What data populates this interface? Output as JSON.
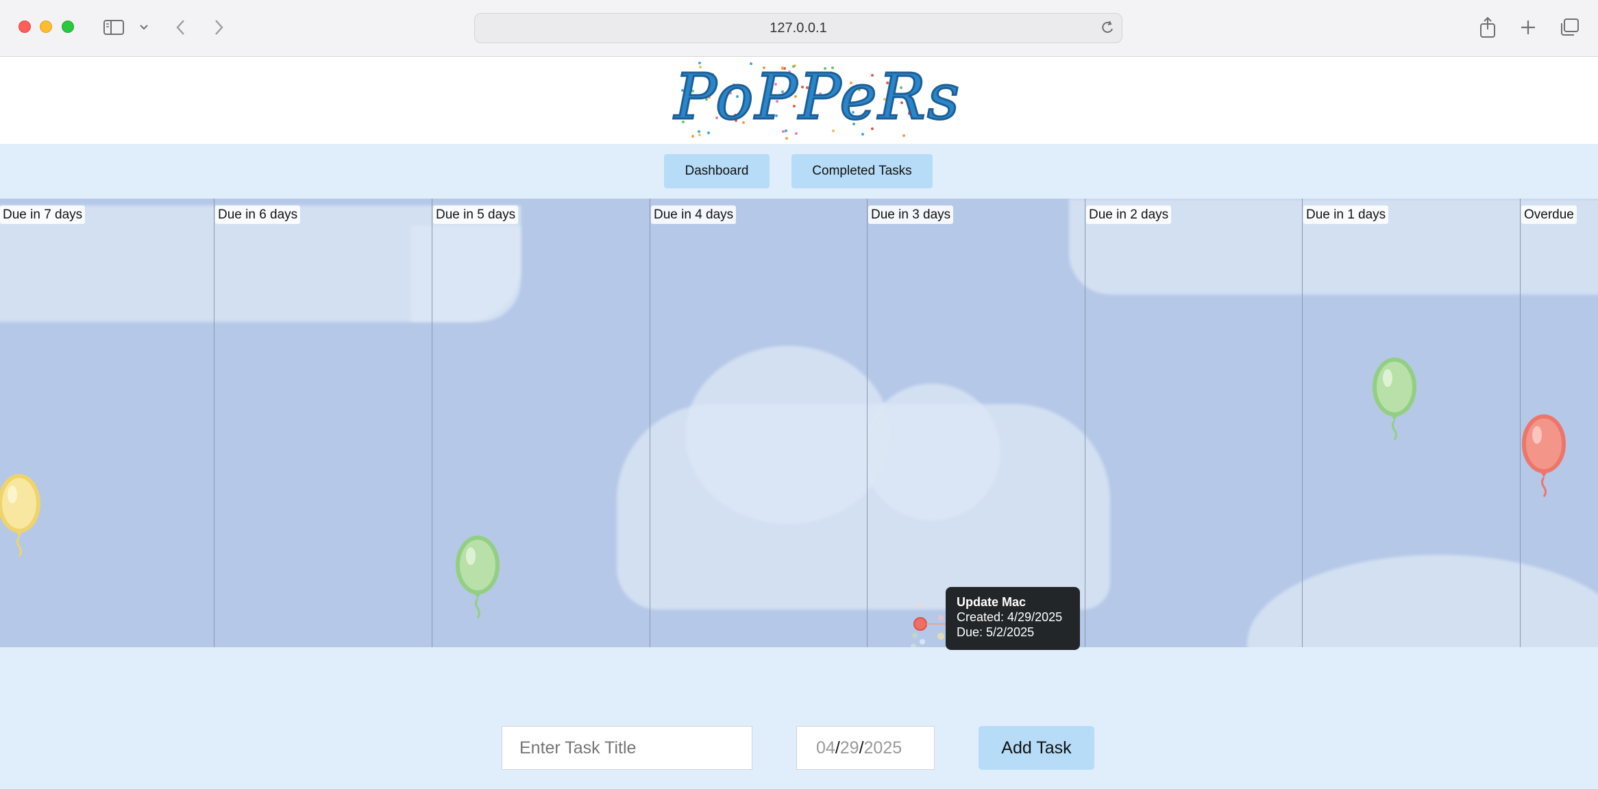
{
  "browser": {
    "url": "127.0.0.1",
    "icons": [
      "sidebar-icon",
      "chevron-down-icon",
      "back-icon",
      "forward-icon",
      "reload-icon",
      "share-icon",
      "new-tab-icon",
      "tabs-overview-icon"
    ]
  },
  "app": {
    "logo_text": "PoPPeRs"
  },
  "nav": {
    "dashboard": "Dashboard",
    "completed": "Completed Tasks"
  },
  "columns": [
    {
      "label": "Due in 7 days"
    },
    {
      "label": "Due in 6 days"
    },
    {
      "label": "Due in 5 days"
    },
    {
      "label": "Due in 4 days"
    },
    {
      "label": "Due in 3 days"
    },
    {
      "label": "Due in 2 days"
    },
    {
      "label": "Due in 1 days"
    },
    {
      "label": "Overdue"
    }
  ],
  "balloons": [
    {
      "color": "#f3df7a",
      "column": "Due in 7 days"
    },
    {
      "color": "#a9d89a",
      "column": "Due in 5 days"
    },
    {
      "color": "#a9d89a",
      "column": "Due in 1 days"
    },
    {
      "color": "#f08a7e",
      "column": "Overdue"
    }
  ],
  "tooltip": {
    "title": "Update Mac",
    "created": "Created: 4/29/2025",
    "due": "Due: 5/2/2025"
  },
  "form": {
    "title_placeholder": "Enter Task Title",
    "date_month": "04",
    "date_day": "29",
    "date_year": "2025",
    "date_sep": "/",
    "add_label": "Add Task"
  },
  "colors": {
    "sky": "#b5c8e7",
    "page_bg": "#e0eefc",
    "button": "#b6dcf8",
    "logo": "#2a86c8"
  }
}
